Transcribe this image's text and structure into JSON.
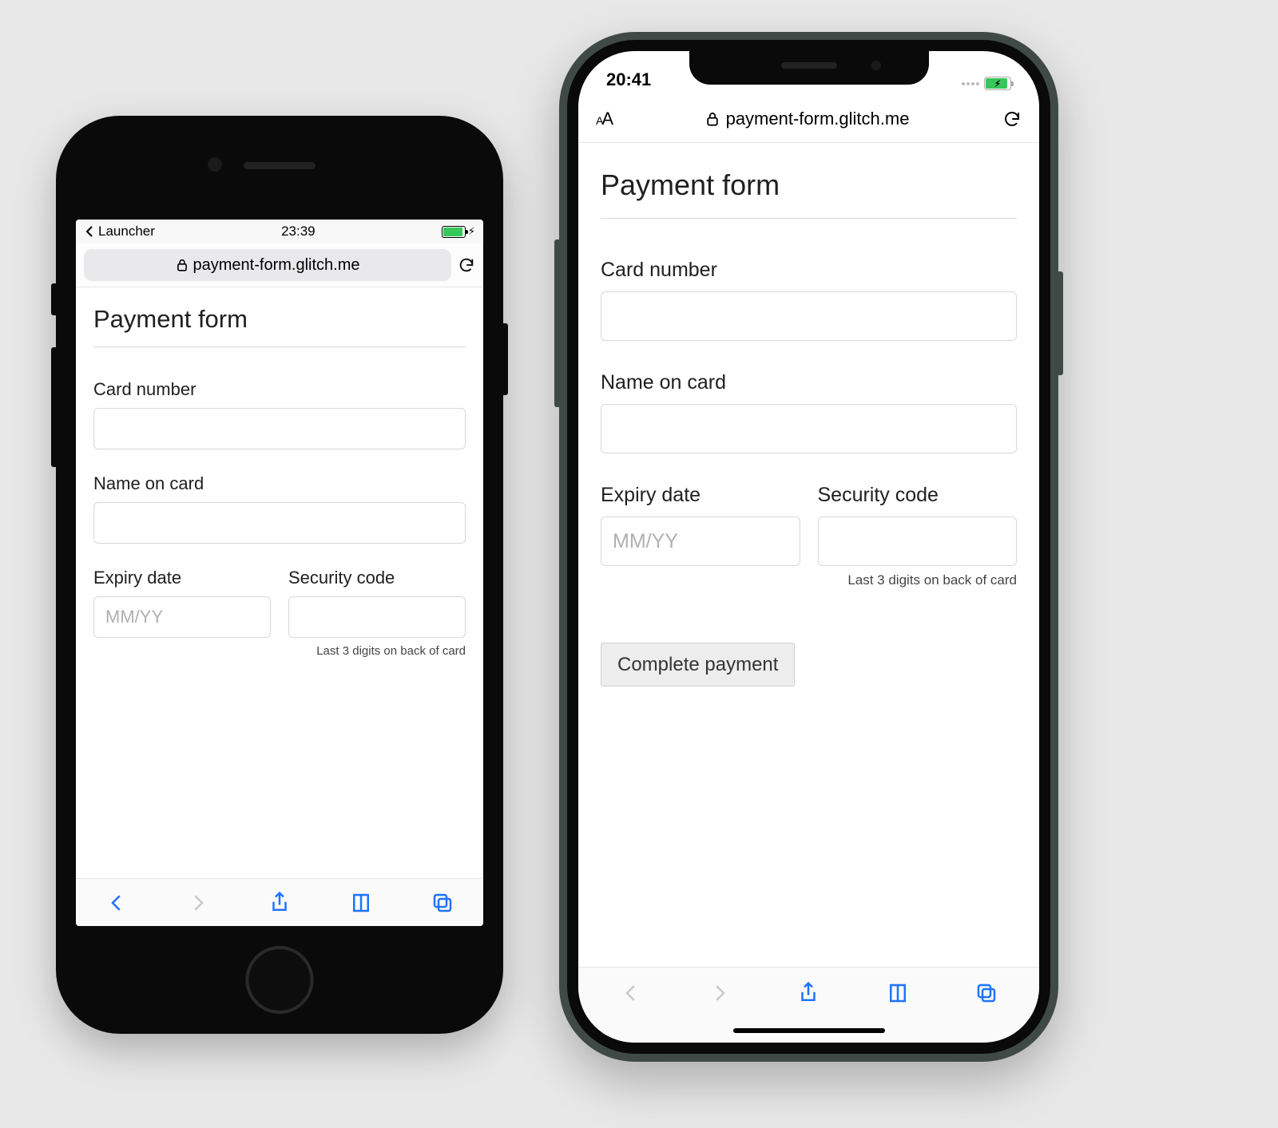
{
  "se": {
    "status": {
      "back_app": "Launcher",
      "time": "23:39"
    },
    "url": "payment-form.glitch.me"
  },
  "x": {
    "status": {
      "time": "20:41"
    },
    "urlbar": {
      "aa": "AA"
    },
    "url": "payment-form.glitch.me"
  },
  "form": {
    "title": "Payment form",
    "card_number_label": "Card number",
    "name_on_card_label": "Name on card",
    "expiry_label": "Expiry date",
    "expiry_placeholder": "MM/YY",
    "security_label": "Security code",
    "security_hint": "Last 3 digits on back of card",
    "submit_label": "Complete payment"
  }
}
